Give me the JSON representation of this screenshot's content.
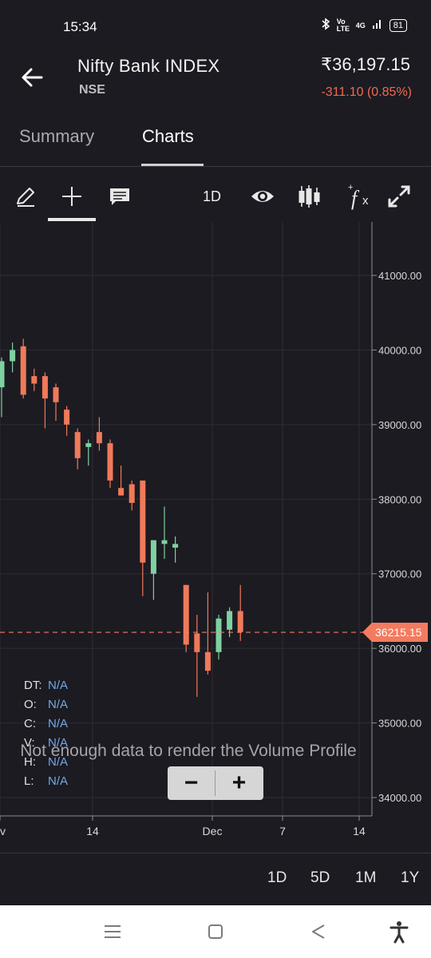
{
  "status_bar": {
    "time": "15:34",
    "network_label": "Vo LTE",
    "signal_label": "4G",
    "battery": "81"
  },
  "header": {
    "title": "Nifty Bank INDEX",
    "exchange": "NSE",
    "price": "₹36,197.15",
    "change": "-311.10 (0.85%)"
  },
  "tabs": [
    {
      "label": "Summary",
      "active": false
    },
    {
      "label": "Charts",
      "active": true
    }
  ],
  "toolbar": {
    "interval": "1D",
    "icons": [
      "pencil-icon",
      "crosshair-icon",
      "comment-icon",
      "eye-icon",
      "candlestick-icon",
      "function-icon",
      "fullscreen-icon"
    ]
  },
  "legend": [
    {
      "key": "DT:",
      "value": "N/A"
    },
    {
      "key": "O:",
      "value": "N/A"
    },
    {
      "key": "C:",
      "value": "N/A"
    },
    {
      "key": "V:",
      "value": "N/A"
    },
    {
      "key": "H:",
      "value": "N/A"
    },
    {
      "key": "L:",
      "value": "N/A"
    }
  ],
  "volume_profile_message": "Not enough data to render the Volume Profile",
  "zoom": {
    "minus": "−",
    "plus": "+"
  },
  "range_buttons": [
    "1D",
    "5D",
    "1M",
    "1Y"
  ],
  "colors": {
    "background": "#1c1b22",
    "up": "#7fd1a0",
    "down": "#f07a5a",
    "current_price_tag": "#f47b5f",
    "change_text": "#f06a4f",
    "legend_value": "#72a8e6"
  },
  "chart_data": {
    "type": "candlestick",
    "y_ticks": [
      "41000.00",
      "40000.00",
      "39000.00",
      "38000.00",
      "37000.00",
      "36000.00",
      "35000.00",
      "34000.00"
    ],
    "x_ticks": [
      "v",
      "14",
      "Dec",
      "7",
      "14"
    ],
    "current_price_label": "36215.15",
    "current_price": 36215.15,
    "ylim": [
      33500,
      41700
    ],
    "candles": [
      {
        "o": 39500,
        "h": 39900,
        "l": 39100,
        "c": 39850
      },
      {
        "o": 39850,
        "h": 40100,
        "l": 39700,
        "c": 40000
      },
      {
        "o": 40050,
        "h": 40150,
        "l": 39350,
        "c": 39400
      },
      {
        "o": 39650,
        "h": 39750,
        "l": 39450,
        "c": 39550
      },
      {
        "o": 39650,
        "h": 39700,
        "l": 38950,
        "c": 39350
      },
      {
        "o": 39500,
        "h": 39550,
        "l": 39050,
        "c": 39300
      },
      {
        "o": 39200,
        "h": 39250,
        "l": 38850,
        "c": 39000
      },
      {
        "o": 38900,
        "h": 38950,
        "l": 38400,
        "c": 38550
      },
      {
        "o": 38700,
        "h": 38800,
        "l": 38450,
        "c": 38750
      },
      {
        "o": 38900,
        "h": 39100,
        "l": 38650,
        "c": 38750
      },
      {
        "o": 38750,
        "h": 38800,
        "l": 38150,
        "c": 38250
      },
      {
        "o": 38150,
        "h": 38450,
        "l": 38050,
        "c": 38050
      },
      {
        "o": 38200,
        "h": 38250,
        "l": 37850,
        "c": 37950
      },
      {
        "o": 38250,
        "h": 38250,
        "l": 36700,
        "c": 37150
      },
      {
        "o": 37000,
        "h": 37450,
        "l": 36650,
        "c": 37450
      },
      {
        "o": 37400,
        "h": 37900,
        "l": 37200,
        "c": 37450
      },
      {
        "o": 37350,
        "h": 37500,
        "l": 37150,
        "c": 37400
      },
      {
        "o": 36850,
        "h": 36850,
        "l": 35950,
        "c": 36050
      },
      {
        "o": 36200,
        "h": 36450,
        "l": 35350,
        "c": 35950
      },
      {
        "o": 35950,
        "h": 36750,
        "l": 35650,
        "c": 35700
      },
      {
        "o": 35950,
        "h": 36450,
        "l": 35850,
        "c": 36400
      },
      {
        "o": 36250,
        "h": 36550,
        "l": 36150,
        "c": 36500
      },
      {
        "o": 36500,
        "h": 36850,
        "l": 36100,
        "c": 36220
      }
    ]
  }
}
